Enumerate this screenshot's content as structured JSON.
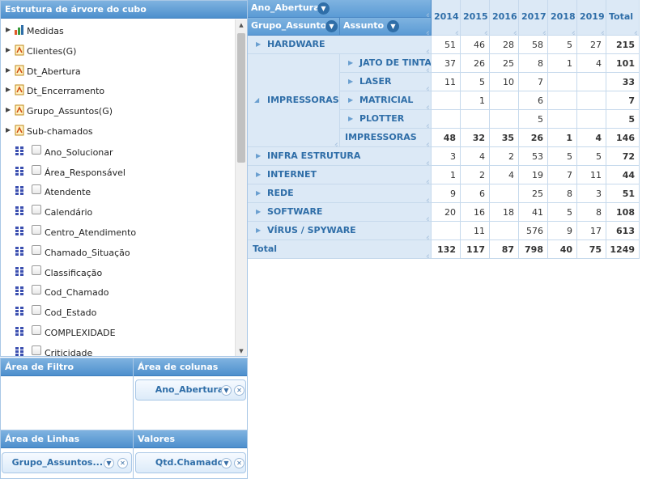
{
  "tree": {
    "title": "Estrutura de árvore do cubo",
    "nodes": [
      {
        "label": "Medidas",
        "icon": "measures-icon",
        "kind": "group"
      },
      {
        "label": "Clientes(G)",
        "icon": "dimension-icon",
        "kind": "group"
      },
      {
        "label": "Dt_Abertura",
        "icon": "dimension-icon",
        "kind": "group"
      },
      {
        "label": "Dt_Encerramento",
        "icon": "dimension-icon",
        "kind": "group"
      },
      {
        "label": "Grupo_Assuntos(G)",
        "icon": "dimension-icon",
        "kind": "group"
      },
      {
        "label": "Sub-chamados",
        "icon": "dimension-icon",
        "kind": "group"
      },
      {
        "label": "Ano_Solucionar",
        "icon": "field-grid-icon",
        "kind": "field"
      },
      {
        "label": "Área_Responsável",
        "icon": "field-grid-icon",
        "kind": "field"
      },
      {
        "label": "Atendente",
        "icon": "field-grid-icon",
        "kind": "field"
      },
      {
        "label": "Calendário",
        "icon": "field-grid-icon",
        "kind": "field"
      },
      {
        "label": "Centro_Atendimento",
        "icon": "field-grid-icon",
        "kind": "field"
      },
      {
        "label": "Chamado_Situação",
        "icon": "field-grid-icon",
        "kind": "field"
      },
      {
        "label": "Classificação",
        "icon": "field-grid-icon",
        "kind": "field"
      },
      {
        "label": "Cod_Chamado",
        "icon": "field-grid-icon",
        "kind": "field"
      },
      {
        "label": "Cod_Estado",
        "icon": "field-grid-icon",
        "kind": "field"
      },
      {
        "label": "COMPLEXIDADE",
        "icon": "field-grid-icon",
        "kind": "field"
      },
      {
        "label": "Criticidade",
        "icon": "field-grid-icon",
        "kind": "field"
      }
    ]
  },
  "zones": {
    "filter": {
      "title": "Área de Filtro"
    },
    "columns": {
      "title": "Área de colunas",
      "chip": "Ano_Abertura"
    },
    "rows": {
      "title": "Área de Linhas",
      "chip": "Grupo_Assuntos..."
    },
    "values": {
      "title": "Valores",
      "chip": "Qtd.Chamado"
    }
  },
  "pivot": {
    "column_field": "Ano_Abertura",
    "row_fields": [
      "Grupo_Assunto",
      "Assunto"
    ],
    "years": [
      "2014",
      "2015",
      "2016",
      "2017",
      "2018",
      "2019"
    ],
    "total_label": "Total",
    "rows": [
      {
        "group": "HARDWARE",
        "sub": "",
        "values": [
          "51",
          "46",
          "28",
          "58",
          "5",
          "27"
        ],
        "total": "215",
        "expanded": false
      },
      {
        "group": "IMPRESSORAS",
        "sub": "JATO DE TINTA",
        "values": [
          "37",
          "26",
          "25",
          "8",
          "1",
          "4"
        ],
        "total": "101"
      },
      {
        "group": "IMPRESSORAS",
        "sub": "LASER",
        "values": [
          "11",
          "5",
          "10",
          "7",
          "",
          ""
        ],
        "total": "33"
      },
      {
        "group": "IMPRESSORAS",
        "sub": "MATRICIAL",
        "values": [
          "",
          "1",
          "",
          "6",
          "",
          ""
        ],
        "total": "7"
      },
      {
        "group": "IMPRESSORAS",
        "sub": "PLOTTER",
        "values": [
          "",
          "",
          "",
          "5",
          "",
          ""
        ],
        "total": "5"
      },
      {
        "group": "IMPRESSORAS",
        "sub": "IMPRESSORAS",
        "values": [
          "48",
          "32",
          "35",
          "26",
          "1",
          "4"
        ],
        "total": "146",
        "subtotal": true
      },
      {
        "group": "INFRA ESTRUTURA",
        "sub": "",
        "values": [
          "3",
          "4",
          "2",
          "53",
          "5",
          "5"
        ],
        "total": "72",
        "expanded": false
      },
      {
        "group": "INTERNET",
        "sub": "",
        "values": [
          "1",
          "2",
          "4",
          "19",
          "7",
          "11"
        ],
        "total": "44",
        "expanded": false
      },
      {
        "group": "REDE",
        "sub": "",
        "values": [
          "9",
          "6",
          "",
          "25",
          "8",
          "3"
        ],
        "total": "51",
        "expanded": false
      },
      {
        "group": "SOFTWARE",
        "sub": "",
        "values": [
          "20",
          "16",
          "18",
          "41",
          "5",
          "8"
        ],
        "total": "108",
        "expanded": false
      },
      {
        "group": "VÍRUS / SPYWARE",
        "sub": "",
        "values": [
          "",
          "11",
          "",
          "576",
          "9",
          "17"
        ],
        "total": "613",
        "expanded": false
      }
    ],
    "grand_total": {
      "label": "Total",
      "values": [
        "132",
        "117",
        "87",
        "798",
        "40",
        "75"
      ],
      "total": "1249"
    }
  }
}
